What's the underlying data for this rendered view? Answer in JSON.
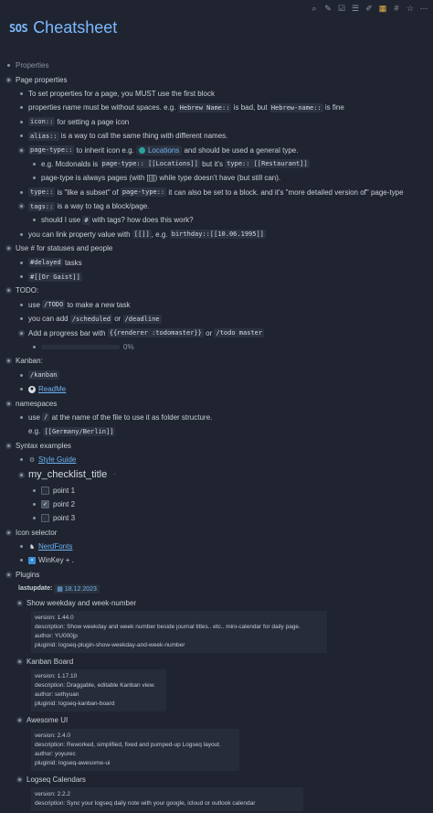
{
  "toolbar": {
    "icons": [
      "search-icon",
      "pencil-icon",
      "check-icon",
      "list-icon",
      "edit-icon",
      "calendar-icon",
      "hash-icon",
      "star-icon",
      "more-icon"
    ]
  },
  "page": {
    "badge": "SOS",
    "title": "Cheatsheet"
  },
  "properties_label": "Properties",
  "page_properties": {
    "heading": "Page properties",
    "i1": "To set properties for a page, you MUST use the first block",
    "i2a": "properties name must be without spaces. e.g.",
    "i2b": "Hebrew Name::",
    "i2c": "is bad, but",
    "i2d": "Hebrew-name::",
    "i2e": "is fine",
    "i3a": "icon::",
    "i3b": "for setting a page icon",
    "i4a": "alias::",
    "i4b": "is a way to call the same thing with different names.",
    "i5a": "page-type::",
    "i5b": "to inherit icon e.g.",
    "i5c": "Locations",
    "i5d": "and should be used a general type.",
    "i6a": "e.g. Mcdonalds is",
    "i6b": "page-type:: [[Locations]]",
    "i6c": "but it's",
    "i6d": "type:: [[Restaurant]]",
    "i7": "page-type is always pages (with [[]]) while type doesn't have (but still can).",
    "i8a": "type::",
    "i8b": "is \"like a subset\" of",
    "i8c": "page-type::",
    "i8d": "it can also be set to a block. and it's \"more detailed version of\" page-type",
    "i9a": "tags::",
    "i9b": "is a way to tag a block/page.",
    "i10a": "should I use",
    "i10b": "#",
    "i10c": "with tags? how does this work?",
    "i11a": "you can link property value with",
    "i11b": "[[]]",
    "i11c": ", e.g.",
    "i11d": "birthday::[[10.06.1995]]"
  },
  "statuses": {
    "heading": "Use # for statuses and people",
    "i1a": "#delayed",
    "i1b": "tasks",
    "i2": "#[[Or Gaist]]"
  },
  "todo": {
    "heading": "TODO:",
    "i1a": "use",
    "i1b": "/TODO",
    "i1c": "to make a new task",
    "i2a": "you can add",
    "i2b": "/scheduled",
    "i2c": "or",
    "i2d": "/deadline",
    "i3a": "Add a progress bar with",
    "i3b": "{{renderer :todomaster}}",
    "i3c": "or",
    "i3d": "/todo master",
    "progress": 0,
    "progress_label": "0%"
  },
  "kanban": {
    "heading": "Kanban:",
    "i1": "/kanban",
    "i2": "ReadMe"
  },
  "namespaces": {
    "heading": "namespaces",
    "i1a": "use",
    "i1b": "/",
    "i1c": "at the name of the file to use it as folder structure.",
    "i1d": "e.g.",
    "i1e": "[[Germany/Berlin]]"
  },
  "syntax": {
    "heading": "Syntax examples",
    "i1": "Style Guide",
    "checklist_title": "my_checklist_title",
    "points": [
      {
        "label": "point 1",
        "checked": false
      },
      {
        "label": "point 2",
        "checked": true
      },
      {
        "label": "point 3",
        "checked": false
      }
    ]
  },
  "icon_selector": {
    "heading": "Icon selector",
    "i1": "NerdFonts",
    "i2": "WinKey + ."
  },
  "plugins": {
    "heading": "Plugins",
    "lastupdate_label": "lastupdate:",
    "lastupdate_value": "18.12.2023",
    "items": [
      {
        "name": "Show weekday and week-number",
        "lines": [
          "version: 1.44.0",
          "description: Show weekday and week number beside journal titles.. etc.. mini-calendar for daily page.",
          "author: YU000jp",
          "pluginid: logseq-plugin-show-weekday-and-week-number"
        ]
      },
      {
        "name": "Kanban Board",
        "lines": [
          "version: 1.17.10",
          "description: Draggable, editable Kanban view.",
          "author: sethyuan",
          "pluginid: logseq-kanban-board"
        ]
      },
      {
        "name": "Awesome UI",
        "lines": [
          "version: 2.4.0",
          "description: Reworked, simplified, fixed and pumped-up Logseq layout.",
          "author: yoyurec",
          "pluginid: logseq-awesome-ui"
        ]
      },
      {
        "name": "Logseq Calendars",
        "lines": [
          "version: 2.2.2",
          "description: Sync your logseq daily note with your google, icloud or outlook calendar"
        ]
      }
    ]
  }
}
